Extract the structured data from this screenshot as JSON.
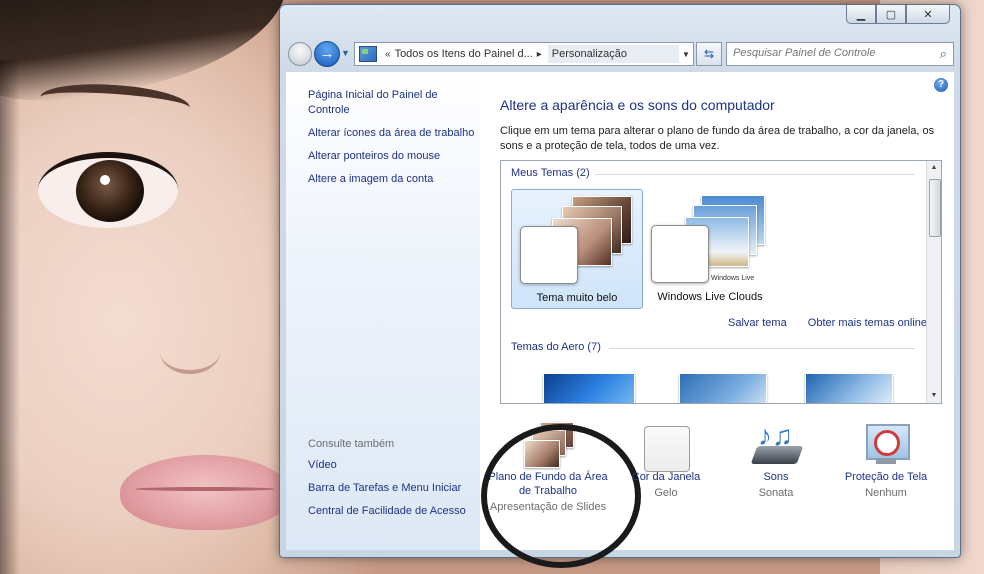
{
  "window": {
    "caption_buttons": [
      "minimize",
      "maximize",
      "close"
    ]
  },
  "nav": {
    "breadcrumb_parent": "Todos os Itens do Painel d...",
    "breadcrumb_current": "Personalização",
    "prefix": "«",
    "separator": "▸",
    "search_placeholder": "Pesquisar Painel de Controle"
  },
  "sidebar": {
    "links": [
      {
        "label": "Página Inicial do Painel de Controle"
      },
      {
        "label": "Alterar ícones da área de trabalho"
      },
      {
        "label": "Alterar ponteiros do mouse"
      },
      {
        "label": "Altere a imagem da conta"
      }
    ],
    "see_also_title": "Consulte também",
    "see_also": [
      {
        "label": "Vídeo"
      },
      {
        "label": "Barra de Tarefas e Menu Iniciar"
      },
      {
        "label": "Central de Facilidade de Acesso"
      }
    ]
  },
  "main": {
    "title": "Altere a aparência e os sons do computador",
    "description": "Clique em um tema para alterar o plano de fundo da área de trabalho, a cor da janela, os sons e a proteção de tela, todos de uma vez.",
    "my_themes_title": "Meus Temas (2)",
    "my_themes": [
      {
        "label": "Tema muito belo",
        "selected": true
      },
      {
        "label": "Windows Live Clouds",
        "selected": false,
        "badge": "Windows Live"
      }
    ],
    "save_theme_link": "Salvar tema",
    "more_themes_link": "Obter mais temas online",
    "aero_themes_title": "Temas do Aero (7)"
  },
  "bottom": {
    "items": [
      {
        "label": "Plano de Fundo da Área de Trabalho",
        "value": "Apresentação de Slides",
        "icon": "slideshow-icon"
      },
      {
        "label": "Cor da Janela",
        "value": "Gelo",
        "icon": "window-color-icon"
      },
      {
        "label": "Sons",
        "value": "Sonata",
        "icon": "sounds-icon"
      },
      {
        "label": "Proteção de Tela",
        "value": "Nenhum",
        "icon": "screensaver-icon"
      }
    ]
  },
  "colors": {
    "link": "#1e3287",
    "sidebar_top": "#ffffff",
    "sidebar_bottom": "#dde8f6",
    "selected_tile": "#cfe4fa"
  }
}
